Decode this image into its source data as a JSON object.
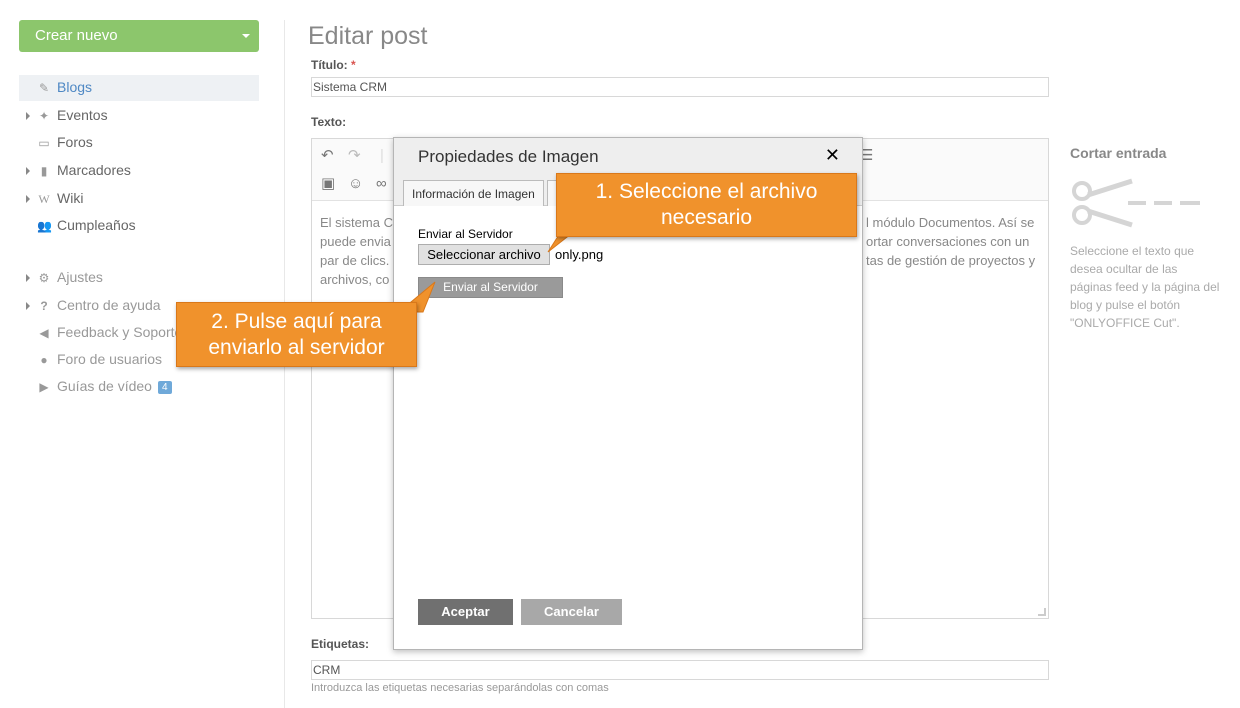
{
  "sidebar": {
    "create_label": "Crear nuevo",
    "items": [
      {
        "label": "Blogs",
        "icon": "edit-icon"
      },
      {
        "label": "Eventos",
        "icon": "megaphone-icon"
      },
      {
        "label": "Foros",
        "icon": "chat-icon"
      },
      {
        "label": "Marcadores",
        "icon": "bookmark-icon"
      },
      {
        "label": "Wiki",
        "icon": "wiki-icon"
      },
      {
        "label": "Cumpleaños",
        "icon": "users-icon"
      }
    ],
    "secondary": [
      {
        "label": "Ajustes",
        "icon": "gear-icon"
      },
      {
        "label": "Centro de ayuda",
        "icon": "question-icon"
      },
      {
        "label": "Feedback y Soporte",
        "icon": "megaphone-icon"
      },
      {
        "label": "Foro de usuarios",
        "icon": "chat-icon"
      },
      {
        "label": "Guías de vídeo",
        "icon": "play-icon",
        "badge": "4"
      }
    ]
  },
  "main": {
    "page_title": "Editar post",
    "title_label": "Título:",
    "required_mark": "*",
    "title_value": "Sistema CRM",
    "text_label": "Texto:",
    "content_left": "El sistema C puede envia par de clics. archivos, co",
    "content_right": "l módulo Documentos. Así se ortar conversaciones con un tas de gestión de proyectos y",
    "tags_label": "Etiquetas:",
    "tags_value": "CRM",
    "tags_hint": "Introduzca las etiquetas necesarias separándolas con comas"
  },
  "cut_panel": {
    "title": "Cortar entrada",
    "description": "Seleccione el texto que desea ocultar de las páginas feed y la página del blog y pulse el botón \"ONLYOFFICE Cut\"."
  },
  "dialog": {
    "title": "Propiedades de Imagen",
    "close": "✕",
    "tab_info": "Información de Imagen",
    "section_label": "Enviar al Servidor",
    "choose_file_label": "Seleccionar archivo",
    "file_name": "only.png",
    "send_label": "Enviar al Servidor",
    "ok_label": "Aceptar",
    "cancel_label": "Cancelar"
  },
  "callouts": {
    "step1": "1. Seleccione el archivo necesario",
    "step2": "2. Pulse aquí para enviarlo al servidor"
  },
  "colors": {
    "create_button": "#8cc66c",
    "callout": "#f0922c",
    "active_link": "#4e88c4"
  }
}
